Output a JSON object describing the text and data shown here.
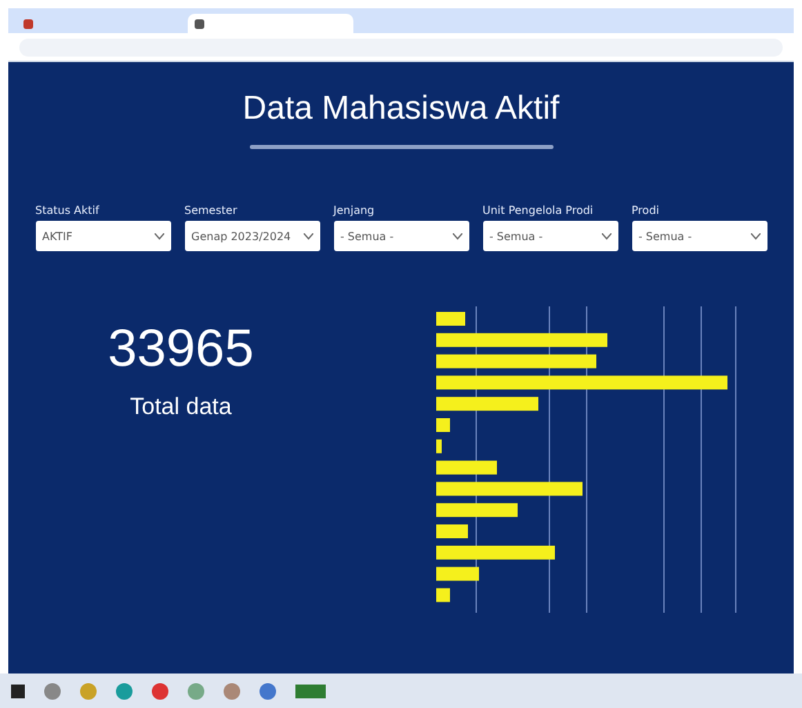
{
  "page": {
    "title": "Data Mahasiswa Aktif"
  },
  "filters": [
    {
      "label": "Status Aktif",
      "value": "AKTIF"
    },
    {
      "label": "Semester",
      "value": "Genap 2023/2024"
    },
    {
      "label": "Jenjang",
      "value": "- Semua -"
    },
    {
      "label": "Unit Pengelola Prodi",
      "value": "- Semua -"
    },
    {
      "label": "Prodi",
      "value": "- Semua -"
    }
  ],
  "summary": {
    "total": "33965",
    "caption": "Total data"
  }
}
